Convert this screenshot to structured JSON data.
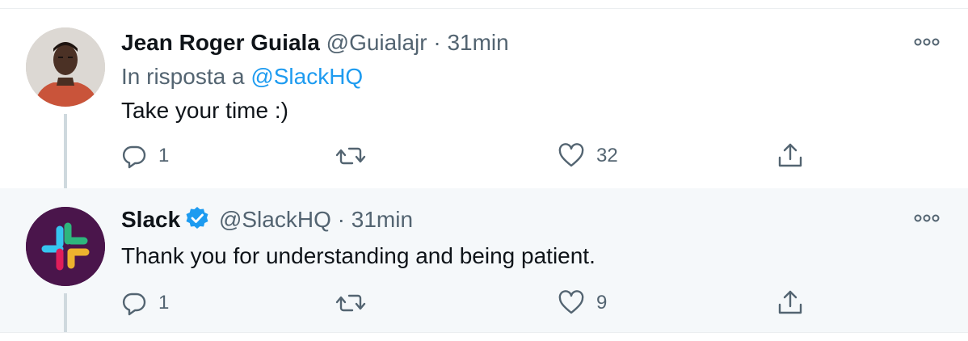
{
  "tweets": [
    {
      "name": "Jean Roger Guiala",
      "handle": "@Guialajr",
      "separator": "·",
      "time": "31min",
      "reply_prefix": "In risposta a",
      "reply_mention": "@SlackHQ",
      "text": "Take your time :)",
      "replies": "1",
      "likes": "32",
      "verified": false
    },
    {
      "name": "Slack",
      "handle": "@SlackHQ",
      "separator": "·",
      "time": "31min",
      "text": "Thank you for understanding and being patient.",
      "replies": "1",
      "likes": "9",
      "verified": true
    }
  ],
  "colors": {
    "text": "#0f1419",
    "secondary": "#536471",
    "accent": "#1d9bf0",
    "highlight_bg": "#f5f8fa",
    "slack_bg": "#4a154b"
  },
  "icons": [
    "reply-icon",
    "retweet-icon",
    "like-icon",
    "share-icon",
    "more-icon",
    "verified-badge-icon"
  ]
}
